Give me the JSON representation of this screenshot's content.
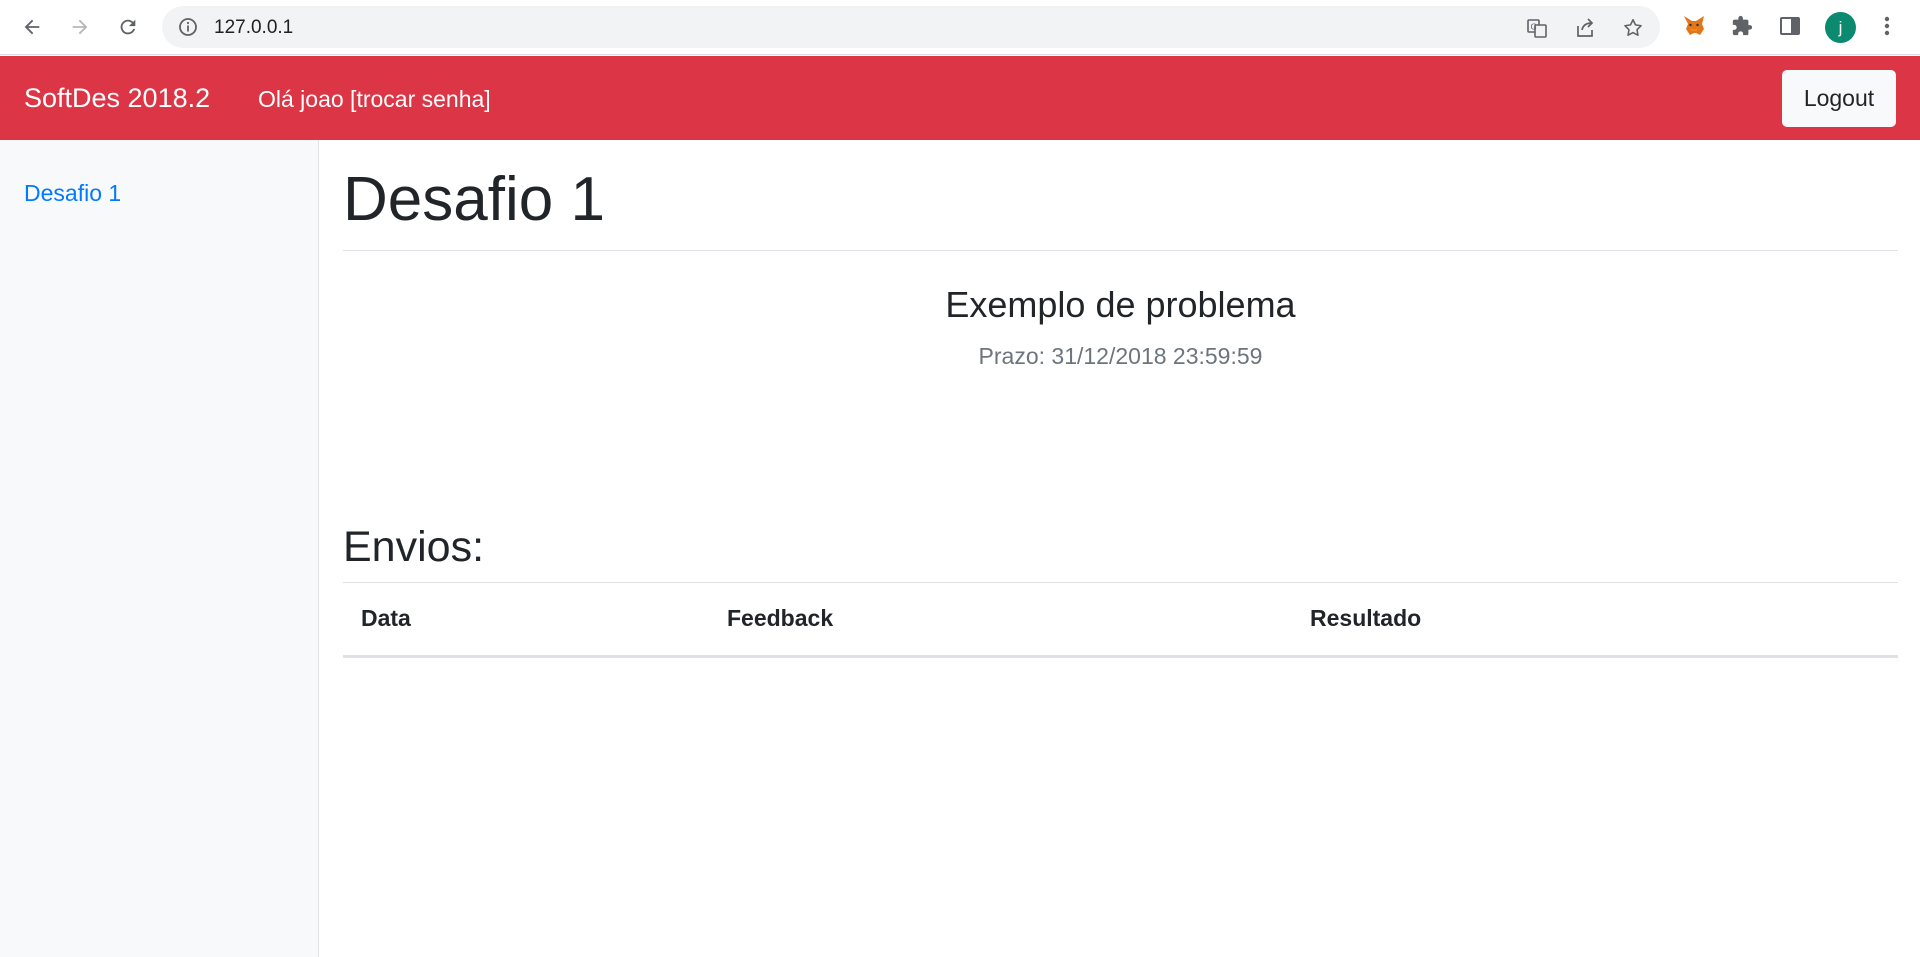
{
  "browser": {
    "url": "127.0.0.1",
    "profile_initial": "j",
    "icons": [
      "back-arrow-icon",
      "forward-arrow-icon",
      "reload-icon",
      "site-info-icon",
      "translate-icon",
      "share-icon",
      "bookmark-star-icon",
      "metamask-fox-icon",
      "extensions-puzzle-icon",
      "side-panel-icon",
      "kebab-menu-icon"
    ]
  },
  "navbar": {
    "brand": "SoftDes 2018.2",
    "greeting": "Olá joao [trocar senha]",
    "logout_label": "Logout",
    "color": "#dc3545"
  },
  "sidebar": {
    "items": [
      {
        "label": "Desafio 1"
      }
    ]
  },
  "main": {
    "title": "Desafio 1",
    "problem_title": "Exemplo de problema",
    "deadline": "Prazo: 31/12/2018 23:59:59",
    "submissions_title": "Envios:",
    "table": {
      "headers": [
        "Data",
        "Feedback",
        "Resultado"
      ],
      "rows": []
    }
  }
}
